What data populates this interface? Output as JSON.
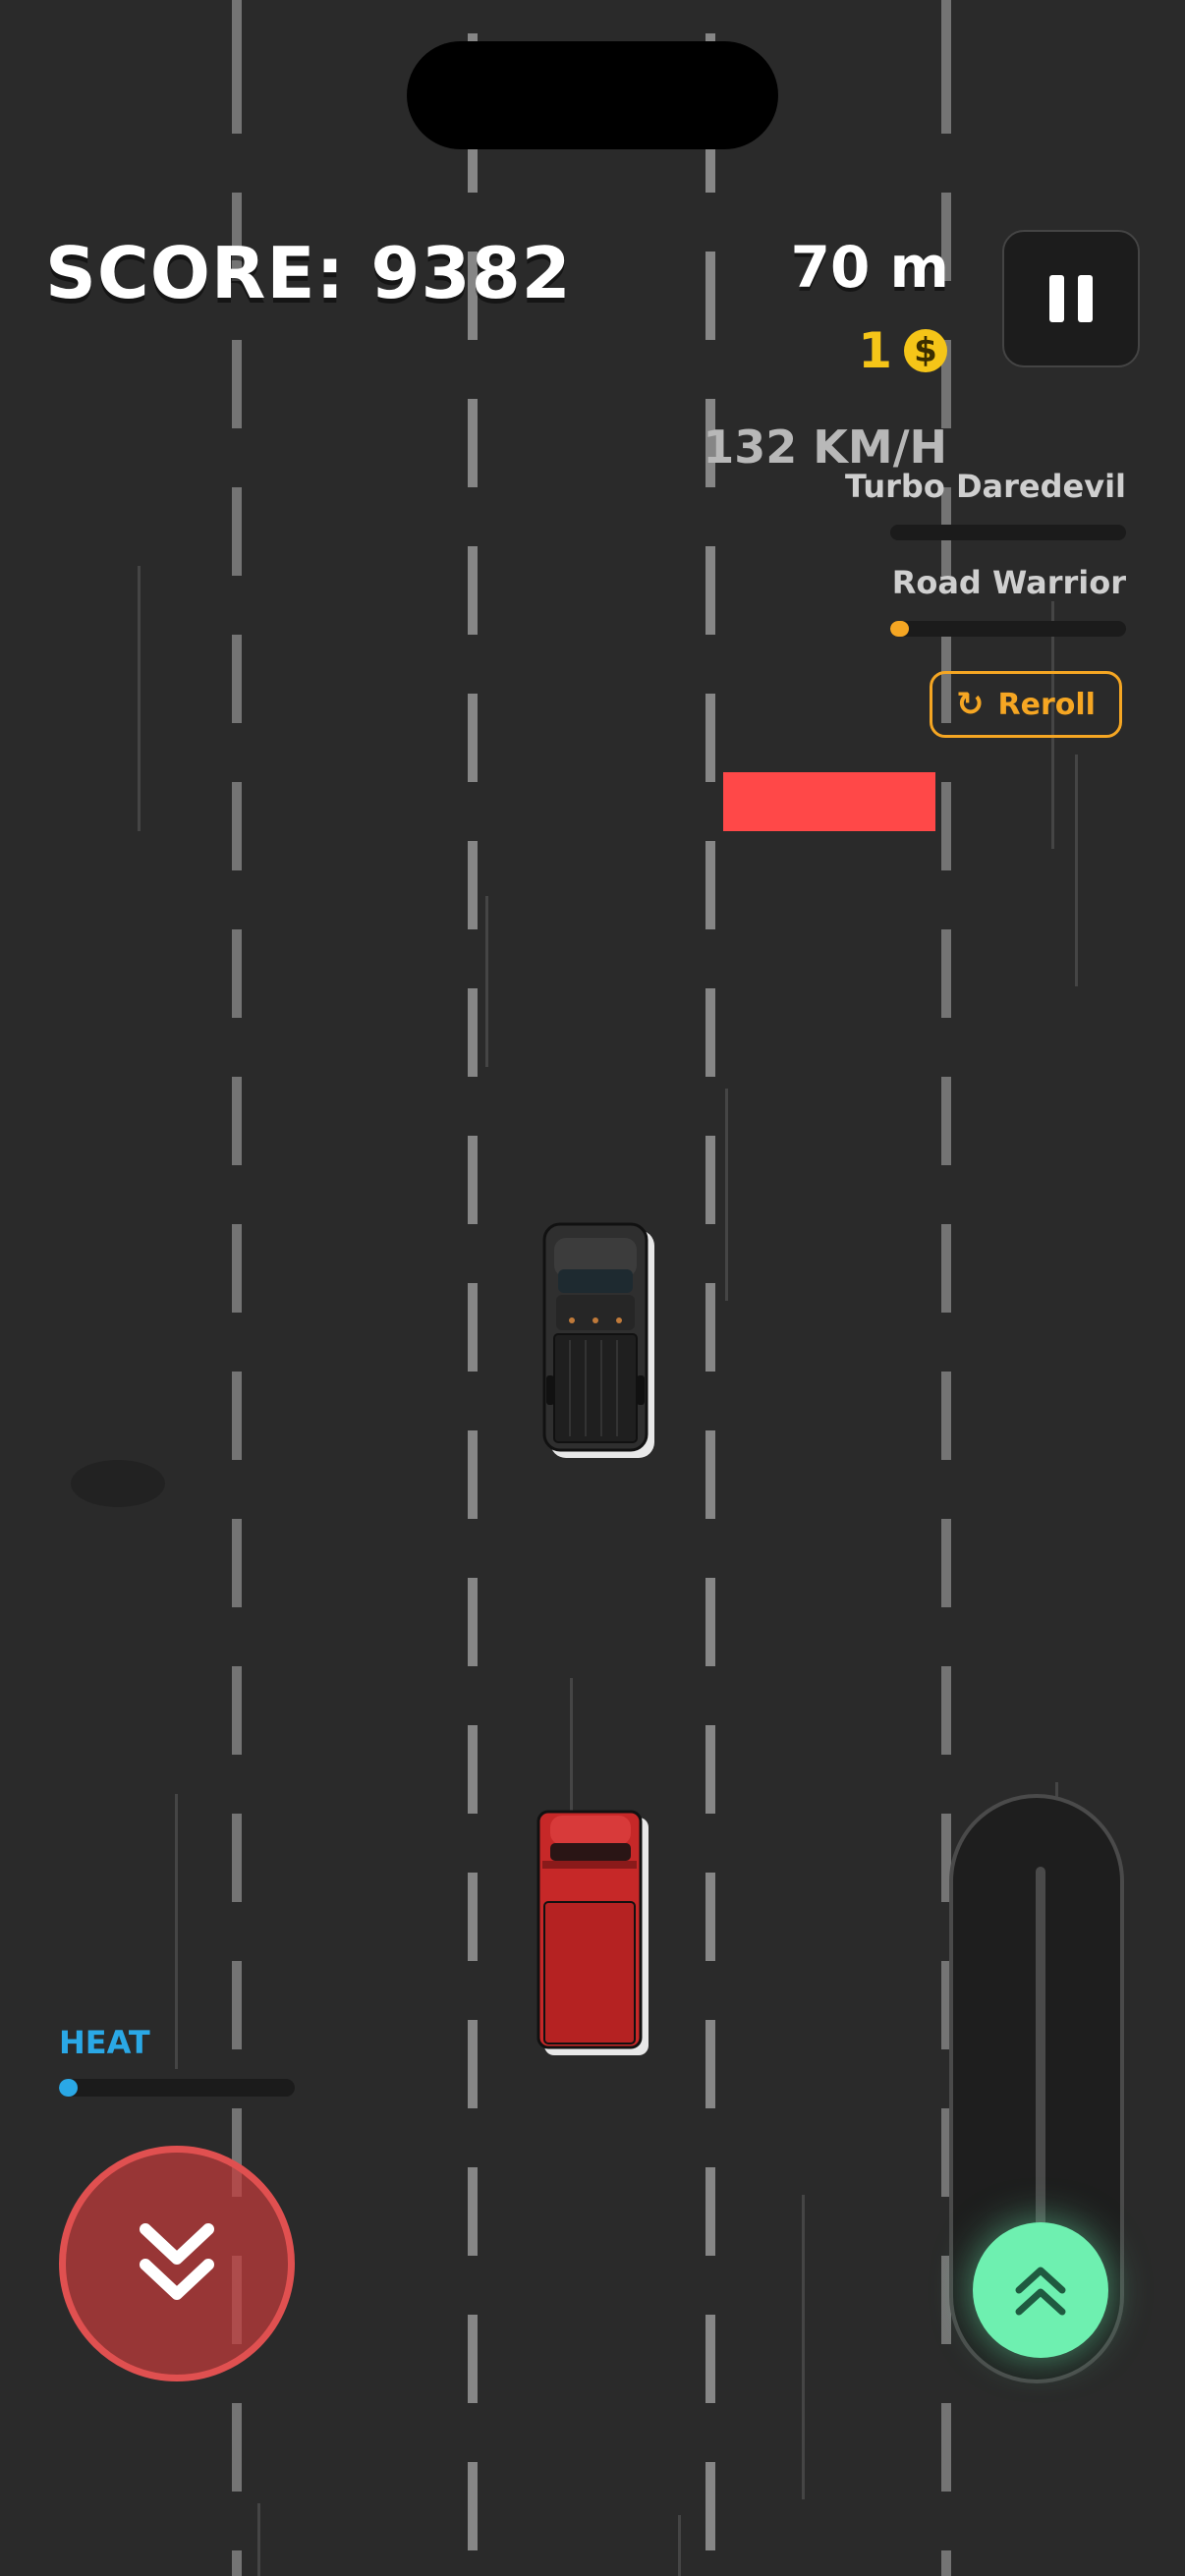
{
  "hud": {
    "score": "SCORE: 9382",
    "distance": "70 m",
    "coins": "1",
    "coin_symbol": "$",
    "speed": "132 KM/H"
  },
  "missions": [
    {
      "label": "Turbo Daredevil",
      "progress": 0.0
    },
    {
      "label": "Road Warrior",
      "progress": 0.08
    }
  ],
  "reroll_button": {
    "label": "Reroll",
    "icon": "refresh-icon"
  },
  "heat": {
    "label": "HEAT",
    "level": 0.05
  },
  "controls": {
    "brake_icon": "chevron-double-down-icon",
    "throttle_icon": "chevron-double-up-icon",
    "throttle_level": 1.0
  },
  "colors": {
    "road": "#2a2a2a",
    "coin": "#f5c518",
    "mission_accent": "#f5a623",
    "heat": "#2aa8e6",
    "brake": "#e05050",
    "throttle": "#6ef0b0",
    "obstacle": "#ff4848",
    "pickup_truck": "#2f2f2f",
    "red_truck": "#c62828"
  }
}
